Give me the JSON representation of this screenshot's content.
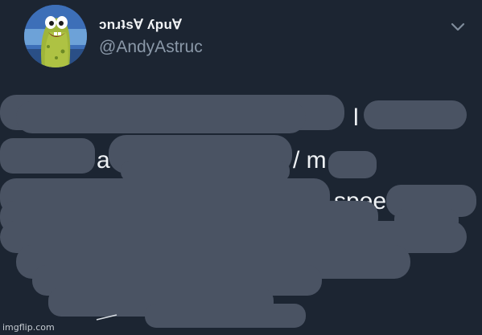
{
  "tweet": {
    "author": {
      "display_name": "ɔnɹʇsⱯ ʎpuⱯ",
      "handle": "@AndyAstruc",
      "avatar_icon": "sea-creature-avatar"
    },
    "menu_icon": "chevron-down-icon",
    "visible_fragments": {
      "line1": "l",
      "line2_a": "a",
      "line2_b": "/ m",
      "line3": "speed"
    },
    "redaction_color": "#4a5363"
  },
  "watermark": "imgflip.com"
}
